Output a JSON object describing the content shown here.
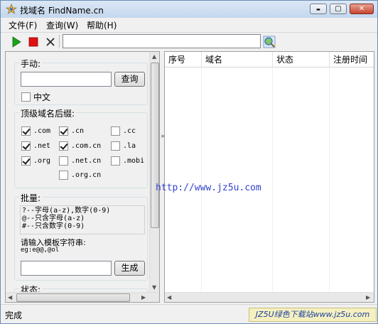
{
  "window": {
    "title": "找域名 FindName.cn",
    "controls": {
      "minimize": "▬",
      "maximize": "▢",
      "close": "✕"
    }
  },
  "menu": [
    {
      "label": "文件(F)"
    },
    {
      "label": "查询(W)"
    },
    {
      "label": "帮助(H)"
    }
  ],
  "toolbar": {
    "url_value": "",
    "icons": [
      "play-icon",
      "stop-icon",
      "clear-icon",
      "search-globe-icon"
    ]
  },
  "manual": {
    "legend": "手动:",
    "input_value": "",
    "query_button": "查询",
    "chinese_label": "中文",
    "chinese_checked": false
  },
  "tld": {
    "legend": "顶级域名后缀:",
    "options": [
      {
        "label": ".com",
        "checked": true
      },
      {
        "label": ".cn",
        "checked": true
      },
      {
        "label": ".cc",
        "checked": false
      },
      {
        "label": ".net",
        "checked": true
      },
      {
        "label": ".com.cn",
        "checked": true
      },
      {
        "label": ".la",
        "checked": false
      },
      {
        "label": ".org",
        "checked": true
      },
      {
        "label": ".net.cn",
        "checked": false
      },
      {
        "label": ".mobi",
        "checked": false
      },
      {
        "label": ".org.cn",
        "checked": false
      }
    ]
  },
  "batch": {
    "legend": "批量:",
    "help_lines": [
      "?--字母(a-z),数字(0-9)",
      "@--只含字母(a-z)",
      "#--只含数字(0-9)"
    ],
    "template_label": "请输入模板字符串:",
    "example": "eg:e@@,@ol",
    "template_value": "",
    "generate_button": "生成"
  },
  "state": {
    "legend": "状态:"
  },
  "table": {
    "columns": [
      "序号",
      "域名",
      "状态",
      "注册时间"
    ],
    "rows": []
  },
  "watermark_url": "http://www.jz5u.com",
  "status": {
    "text": "完成"
  },
  "footer_banner": "JZ5U绿色下载站www.jz5u.com",
  "colors": {
    "play": "#1aa31a",
    "stop": "#e01010",
    "link": "#3344cc"
  }
}
